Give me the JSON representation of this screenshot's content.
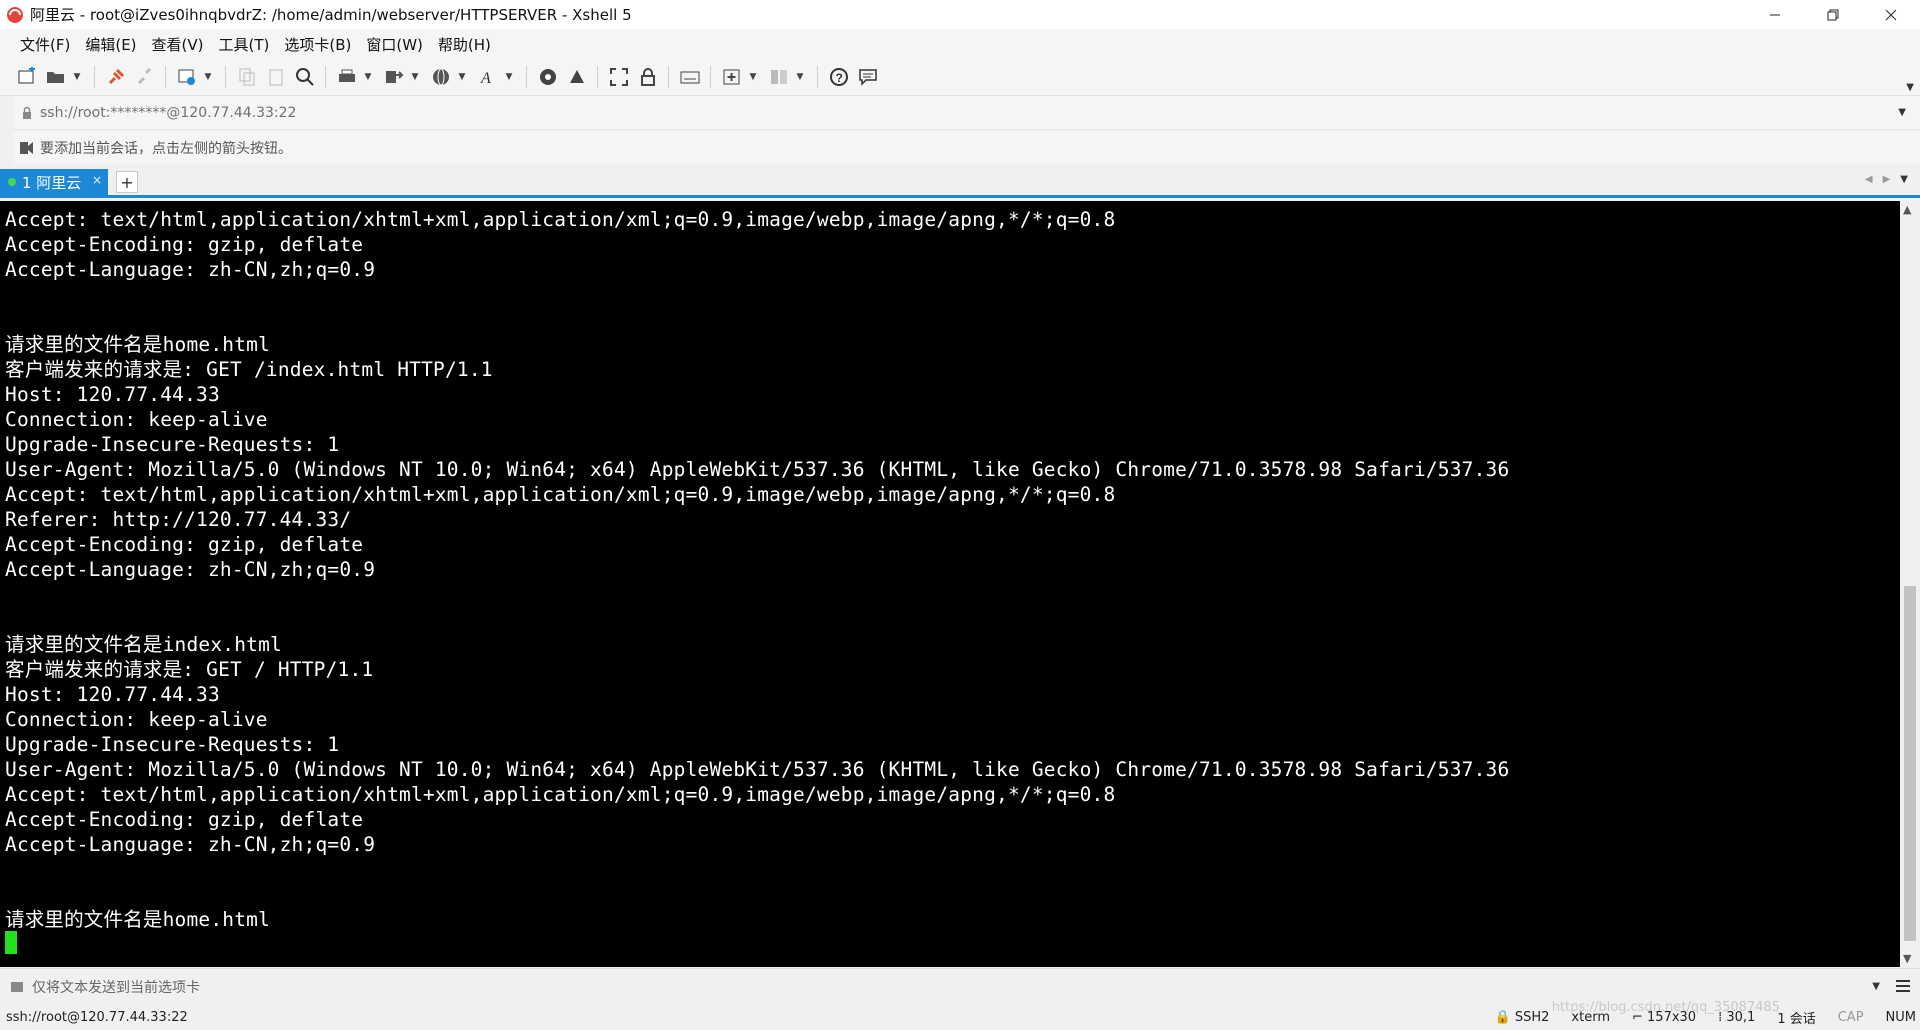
{
  "window": {
    "title": "阿里云 - root@iZves0ihnqbvdrZ: /home/admin/webserver/HTTPSERVER - Xshell 5",
    "icon": "xshell-icon"
  },
  "menu": [
    "文件(F)",
    "编辑(E)",
    "查看(V)",
    "工具(T)",
    "选项卡(B)",
    "窗口(W)",
    "帮助(H)"
  ],
  "address": {
    "value": "ssh://root:********@120.77.44.33:22"
  },
  "links_hint": "要添加当前会话，点击左侧的箭头按钮。",
  "tabs": [
    {
      "label": "1 阿里云",
      "active": true,
      "status_color": "#43d847"
    }
  ],
  "terminal": {
    "lines": [
      "Accept: text/html,application/xhtml+xml,application/xml;q=0.9,image/webp,image/apng,*/*;q=0.8",
      "Accept-Encoding: gzip, deflate",
      "Accept-Language: zh-CN,zh;q=0.9",
      "",
      "",
      "请求里的文件名是home.html",
      "客户端发来的请求是: GET /index.html HTTP/1.1",
      "Host: 120.77.44.33",
      "Connection: keep-alive",
      "Upgrade-Insecure-Requests: 1",
      "User-Agent: Mozilla/5.0 (Windows NT 10.0; Win64; x64) AppleWebKit/537.36 (KHTML, like Gecko) Chrome/71.0.3578.98 Safari/537.36",
      "Accept: text/html,application/xhtml+xml,application/xml;q=0.9,image/webp,image/apng,*/*;q=0.8",
      "Referer: http://120.77.44.33/",
      "Accept-Encoding: gzip, deflate",
      "Accept-Language: zh-CN,zh;q=0.9",
      "",
      "",
      "请求里的文件名是index.html",
      "客户端发来的请求是: GET / HTTP/1.1",
      "Host: 120.77.44.33",
      "Connection: keep-alive",
      "Upgrade-Insecure-Requests: 1",
      "User-Agent: Mozilla/5.0 (Windows NT 10.0; Win64; x64) AppleWebKit/537.36 (KHTML, like Gecko) Chrome/71.0.3578.98 Safari/537.36",
      "Accept: text/html,application/xhtml+xml,application/xml;q=0.9,image/webp,image/apng,*/*;q=0.8",
      "Accept-Encoding: gzip, deflate",
      "Accept-Language: zh-CN,zh;q=0.9",
      "",
      "",
      "请求里的文件名是home.html",
      ""
    ],
    "background": "#000000",
    "foreground": "#ffffff",
    "cursor_color": "#20e020"
  },
  "compose": {
    "text": "仅将文本发送到当前选项卡"
  },
  "status": {
    "connection": "ssh://root@120.77.44.33:22",
    "protocol": "SSH2",
    "terminal_type": "xterm",
    "size": "157x30",
    "cursor_pos": "30,1",
    "sessions": "1 会话",
    "cap": "CAP",
    "num": "NUM",
    "watermark": "https://blog.csdn.net/qq_35087485"
  },
  "colors": {
    "tab_active": "#1e88d8",
    "accent": "#1e88d8"
  }
}
